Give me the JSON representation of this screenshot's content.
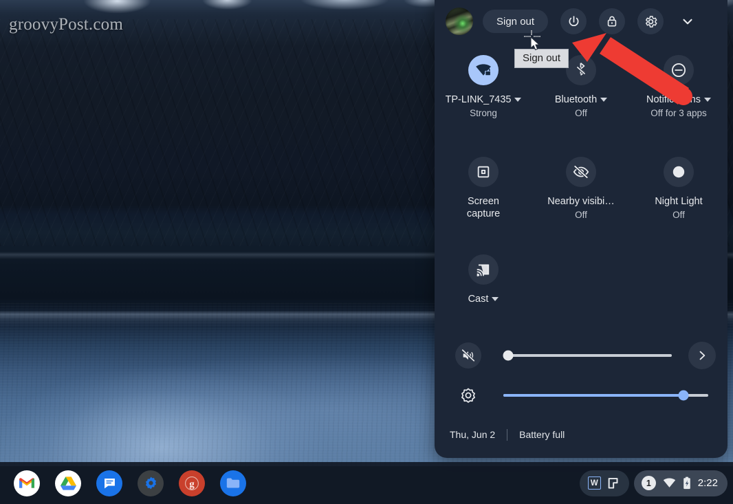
{
  "desktop": {
    "watermark": "groovyPost.com",
    "wallpaper_name": "mountain-lake-night-wallpaper"
  },
  "quick_settings": {
    "avatar_name": "user-avatar",
    "sign_out_label": "Sign out",
    "tooltip_label": "Sign out",
    "header_buttons": [
      {
        "name": "power-button",
        "icon": "power-icon",
        "label": "Power"
      },
      {
        "name": "lock-button",
        "icon": "lock-icon",
        "label": "Lock"
      },
      {
        "name": "settings-button",
        "icon": "gear-icon",
        "label": "Settings"
      },
      {
        "name": "collapse-button",
        "icon": "chevron-down-icon",
        "label": "Collapse"
      }
    ],
    "tiles": [
      {
        "name": "network-tile",
        "icon": "wifi-locked-icon",
        "label": "TP-LINK_7435",
        "label2": "",
        "sub": "Strong",
        "caret": true,
        "active": true
      },
      {
        "name": "bluetooth-tile",
        "icon": "bluetooth-disabled-icon",
        "label": "Bluetooth",
        "label2": "",
        "sub": "Off",
        "caret": true,
        "active": false
      },
      {
        "name": "notifications-tile",
        "icon": "do-not-disturb-icon",
        "label": "Notifications",
        "label2": "",
        "sub": "Off for 3 apps",
        "caret": true,
        "active": false
      },
      {
        "name": "screen-capture-tile",
        "icon": "screen-capture-icon",
        "label": "Screen",
        "label2": "capture",
        "sub": "",
        "caret": false,
        "active": false
      },
      {
        "name": "nearby-visibility-tile",
        "icon": "eye-off-icon",
        "label": "Nearby visibi…",
        "label2": "",
        "sub": "Off",
        "caret": false,
        "active": false
      },
      {
        "name": "night-light-tile",
        "icon": "night-light-icon",
        "label": "Night Light",
        "label2": "",
        "sub": "Off",
        "caret": false,
        "active": false
      },
      {
        "name": "cast-tile",
        "icon": "cast-icon",
        "label": "Cast",
        "label2": "",
        "sub": "",
        "caret": true,
        "active": false
      }
    ],
    "volume": {
      "icon": "volume-mute-icon",
      "value": 3,
      "next_icon": "chevron-right-icon"
    },
    "brightness": {
      "icon": "brightness-icon",
      "value": 88
    },
    "footer": {
      "date": "Thu, Jun 2",
      "battery": "Battery full"
    }
  },
  "shelf": {
    "apps": [
      {
        "name": "gmail-app-icon",
        "label": "Gmail"
      },
      {
        "name": "google-drive-app-icon",
        "label": "Google Drive"
      },
      {
        "name": "messages-app-icon",
        "label": "Messages"
      },
      {
        "name": "settings-app-icon",
        "label": "Settings"
      },
      {
        "name": "groovypost-app-icon",
        "label": "groovyPost"
      },
      {
        "name": "files-app-icon",
        "label": "Files"
      }
    ],
    "tray": {
      "ime_label": "W",
      "stylus_icon": "stylus-icon",
      "notification_count": "1",
      "wifi_icon": "wifi-icon",
      "battery_icon": "battery-charging-icon",
      "time": "2:22"
    }
  },
  "annotation": {
    "arrow_color": "#ee3b33",
    "arrow_name": "red-callout-arrow",
    "points_to": "power-button"
  }
}
